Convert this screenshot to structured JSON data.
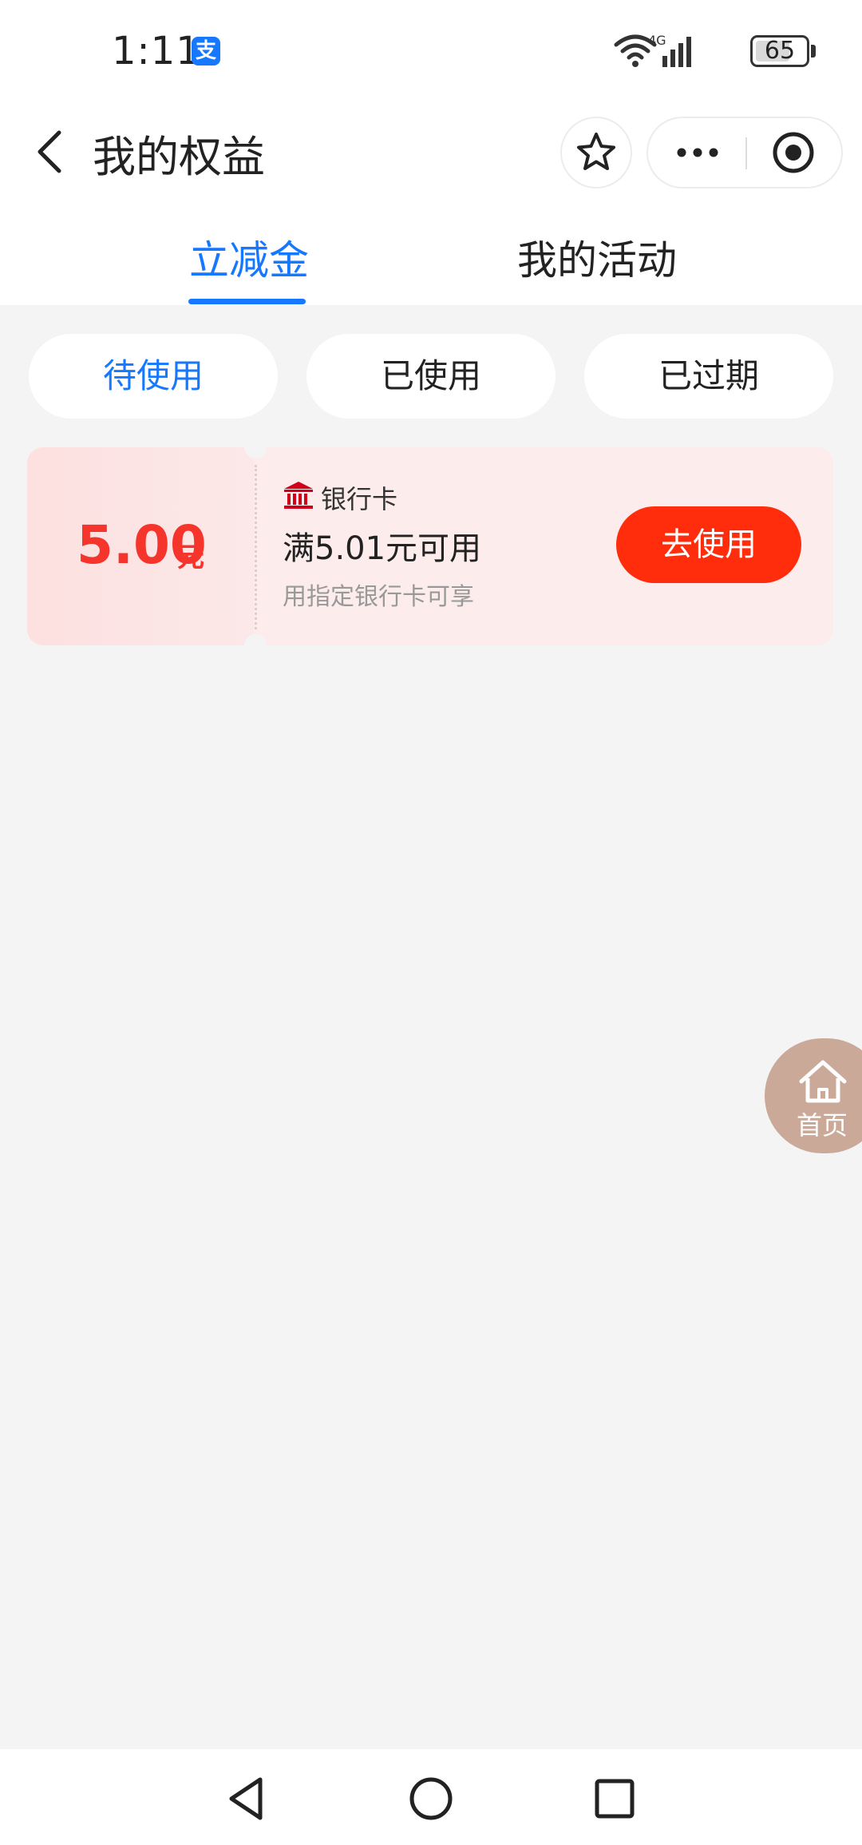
{
  "status_bar": {
    "time": "1:11",
    "app_badge": "支",
    "network": "4G",
    "battery": "65",
    "battery_level": 0.65
  },
  "header": {
    "title": "我的权益",
    "icons": {
      "back": "chevron-left-icon",
      "favorite": "star-icon",
      "more": "more-dots-icon",
      "close": "target-icon"
    }
  },
  "tabs": [
    {
      "label": "立减金",
      "active": true
    },
    {
      "label": "我的活动",
      "active": false
    }
  ],
  "filters": [
    {
      "label": "待使用",
      "active": true
    },
    {
      "label": "已使用",
      "active": false
    },
    {
      "label": "已过期",
      "active": false
    }
  ],
  "coupon": {
    "amount": "5.00",
    "unit": "元",
    "tag": "银行卡",
    "condition": "满5.01元可用",
    "description": "用指定银行卡可享",
    "action": "去使用"
  },
  "home_float": {
    "label": "首页"
  },
  "colors": {
    "accent": "#1677ff",
    "coupon_red": "#f5342c",
    "button_red": "#ff2d0c",
    "coupon_bg": "#fdecec",
    "home_bg": "#c8a594"
  }
}
